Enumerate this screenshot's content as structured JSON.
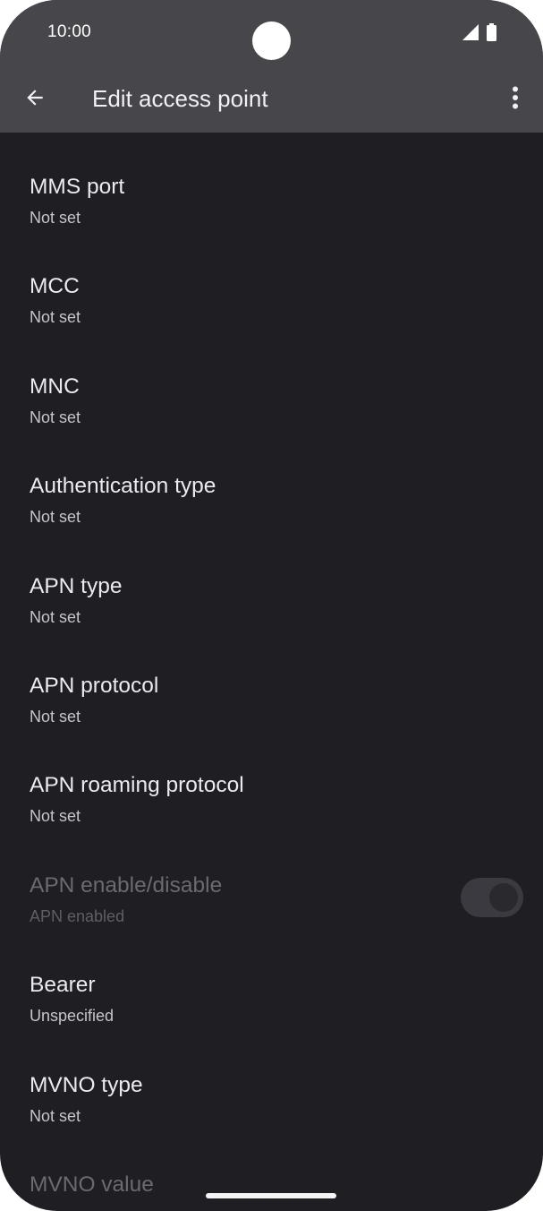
{
  "status_bar": {
    "time": "10:00"
  },
  "app_bar": {
    "title": "Edit access point",
    "back_icon": "arrow-back-icon",
    "more_icon": "more-vert-icon"
  },
  "items": [
    {
      "title": "MMS port",
      "summary": "Not set",
      "enabled": true
    },
    {
      "title": "MCC",
      "summary": "Not set",
      "enabled": true
    },
    {
      "title": "MNC",
      "summary": "Not set",
      "enabled": true
    },
    {
      "title": "Authentication type",
      "summary": "Not set",
      "enabled": true
    },
    {
      "title": "APN type",
      "summary": "Not set",
      "enabled": true
    },
    {
      "title": "APN protocol",
      "summary": "Not set",
      "enabled": true
    },
    {
      "title": "APN roaming protocol",
      "summary": "Not set",
      "enabled": true
    },
    {
      "title": "APN enable/disable",
      "summary": "APN enabled",
      "enabled": false,
      "toggle_on": true
    },
    {
      "title": "Bearer",
      "summary": "Unspecified",
      "enabled": true
    },
    {
      "title": "MVNO type",
      "summary": "Not set",
      "enabled": true
    },
    {
      "title": "MVNO value",
      "summary": "",
      "enabled": false
    }
  ],
  "colors": {
    "app_bar_bg": "#47464b",
    "screen_bg": "#1f1e23"
  }
}
